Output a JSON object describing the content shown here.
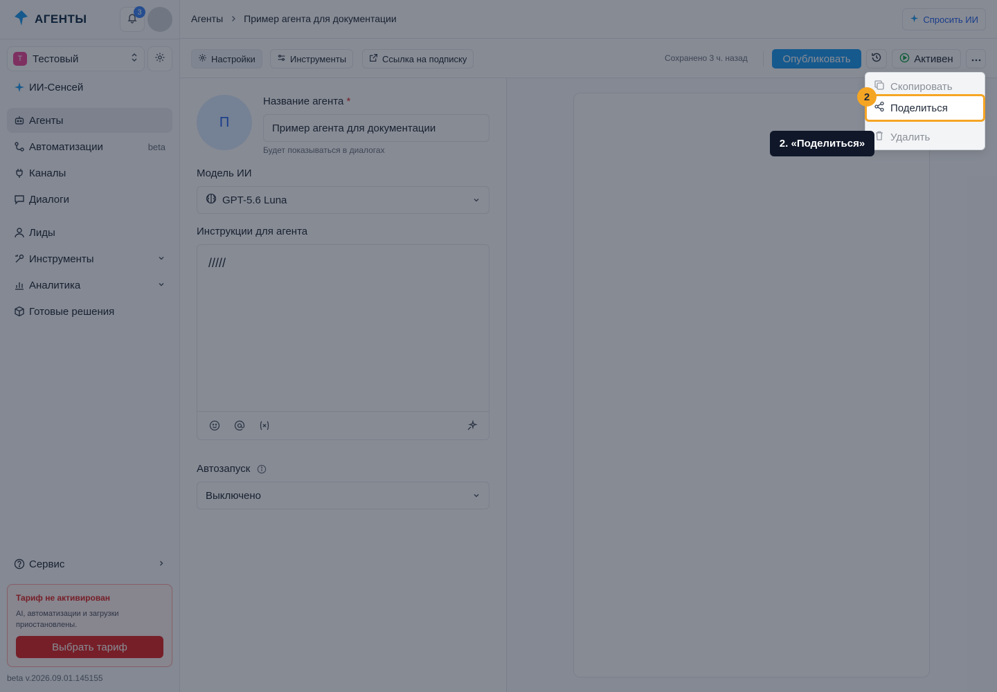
{
  "brand": {
    "name": "АГЕНТЫ"
  },
  "notifications": {
    "count": "3"
  },
  "workspace": {
    "initial": "Т",
    "name": "Тестовый"
  },
  "sidebar": {
    "items": [
      {
        "label": "ИИ-Сенсей",
        "icon": "sparkle-icon"
      },
      {
        "label": "Агенты",
        "icon": "bot-icon",
        "active": true
      },
      {
        "label": "Автоматизации",
        "icon": "workflow-icon",
        "extra": "beta"
      },
      {
        "label": "Каналы",
        "icon": "plug-icon"
      },
      {
        "label": "Диалоги",
        "icon": "chat-icon"
      },
      {
        "label": "Лиды",
        "icon": "user-icon"
      },
      {
        "label": "Инструменты",
        "icon": "tools-icon"
      },
      {
        "label": "Аналитика",
        "icon": "chart-icon"
      },
      {
        "label": "Готовые решения",
        "icon": "box-icon"
      }
    ],
    "service": "Сервис",
    "tariff": {
      "title": "Тариф не активирован",
      "text": "AI, автоматизации и загрузки приостановлены.",
      "button": "Выбрать тариф"
    },
    "version": "beta v.2026.09.01.145155"
  },
  "breadcrumb": {
    "root": "Агенты",
    "current": "Пример агента для документации"
  },
  "ask_ai": "Спросить ИИ",
  "toolbar": {
    "tabs": [
      "Настройки",
      "Инструменты",
      "Ссылка на подписку"
    ],
    "saved": "Сохранено 3 ч. назад",
    "publish": "Опубликовать",
    "status": "Активен"
  },
  "form": {
    "avatar_letter": "П",
    "name_label": "Название агента",
    "required_mark": "*",
    "name_value": "Пример агента для документации",
    "name_hint": "Будет показываться в диалогах",
    "model_label": "Модель ИИ",
    "model_value": "GPT-5.6 Luna",
    "instructions_label": "Инструкции для агента",
    "instructions_value": "/////",
    "autostart_label": "Автозапуск",
    "autostart_value": "Выключено"
  },
  "menu": {
    "items": [
      "Скопировать",
      "Поделиться",
      "Удалить"
    ]
  },
  "guide": {
    "step": "2",
    "tooltip": "2. «Поделиться»",
    "accent": "#f5a524"
  },
  "colors": {
    "primary": "#1d9bf0",
    "danger": "#dc2626",
    "active_status": "#16a34a"
  }
}
